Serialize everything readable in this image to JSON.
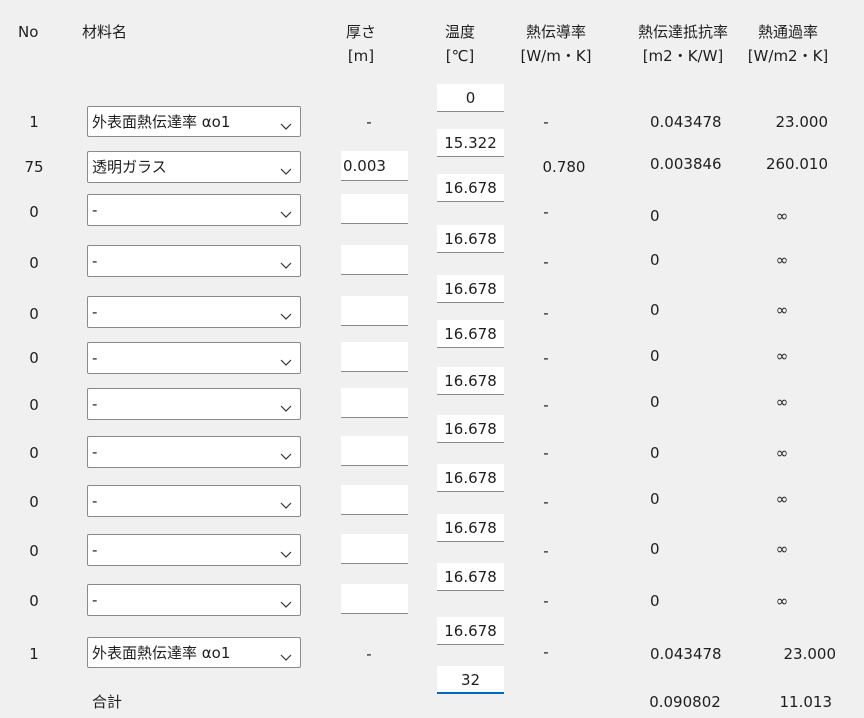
{
  "headers": {
    "no": "No",
    "material": "材料名",
    "thickness": "厚さ",
    "thickness_unit": "[m]",
    "temperature": "温度",
    "temperature_unit": "[℃]",
    "conductivity": "熱伝導率",
    "conductivity_unit": "[W/m・K]",
    "resistance": "熱伝達抵抗率",
    "resistance_unit": "[m2・K/W]",
    "transmittance": "熱通過率",
    "transmittance_unit": "[W/m2・K]"
  },
  "rows": [
    {
      "no": "1",
      "material": "外表面熱伝達率 αo1",
      "thickness": "-",
      "conductivity": "-",
      "resistance": "0.043478",
      "transmittance": "23.000"
    },
    {
      "no": "75",
      "material": "透明ガラス",
      "thickness": "0.003",
      "conductivity": "0.780",
      "resistance": "0.003846",
      "transmittance": "260.010"
    },
    {
      "no": "0",
      "material": "-",
      "thickness": "",
      "conductivity": "-",
      "resistance": "0",
      "transmittance": "∞"
    },
    {
      "no": "0",
      "material": "-",
      "thickness": "",
      "conductivity": "-",
      "resistance": "0",
      "transmittance": "∞"
    },
    {
      "no": "0",
      "material": "-",
      "thickness": "",
      "conductivity": "-",
      "resistance": "0",
      "transmittance": "∞"
    },
    {
      "no": "0",
      "material": "-",
      "thickness": "",
      "conductivity": "-",
      "resistance": "0",
      "transmittance": "∞"
    },
    {
      "no": "0",
      "material": "-",
      "thickness": "",
      "conductivity": "-",
      "resistance": "0",
      "transmittance": "∞"
    },
    {
      "no": "0",
      "material": "-",
      "thickness": "",
      "conductivity": "-",
      "resistance": "0",
      "transmittance": "∞"
    },
    {
      "no": "0",
      "material": "-",
      "thickness": "",
      "conductivity": "-",
      "resistance": "0",
      "transmittance": "∞"
    },
    {
      "no": "0",
      "material": "-",
      "thickness": "",
      "conductivity": "-",
      "resistance": "0",
      "transmittance": "∞"
    },
    {
      "no": "0",
      "material": "-",
      "thickness": "",
      "conductivity": "-",
      "resistance": "0",
      "transmittance": "∞"
    },
    {
      "no": "1",
      "material": "外表面熱伝達率 αo1",
      "thickness": "-",
      "conductivity": "-",
      "resistance": "0.043478",
      "transmittance": "23.000"
    }
  ],
  "temperatures": [
    "0",
    "15.322",
    "16.678",
    "16.678",
    "16.678",
    "16.678",
    "16.678",
    "16.678",
    "16.678",
    "16.678",
    "16.678",
    "16.678",
    "32"
  ],
  "total": {
    "label": "合計",
    "resistance": "0.090802",
    "transmittance": "11.013"
  },
  "colors": {
    "background": "#f0f0f0",
    "focus_underline": "#0067c0"
  }
}
